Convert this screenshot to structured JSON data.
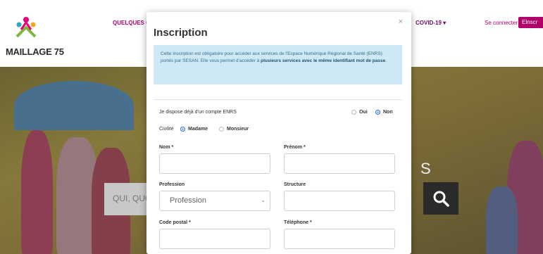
{
  "site": {
    "logo_text": "MAILLAGE 75",
    "nav": {
      "quelques": "QUELQUES O",
      "covid": "COVID-19 ▾",
      "login": "Se connecter",
      "signup_button": "Elnscr"
    },
    "hero": {
      "search_placeholder": "QUI, QUO",
      "side_letter": "S"
    }
  },
  "modal": {
    "title": "Inscription",
    "close": "×",
    "info_text": "Cette inscription est obligatoire pour accéder aux services de l'Espace Numérique Régional de Santé (ENRS) portés par SESAN. Elle vous permet d'accéder à ",
    "info_bold": "plusieurs services avec le même identifiant mot de passe",
    "info_end": ".",
    "enrs_question": "Je dispose déjà d'un compte ENRS",
    "enrs_options": [
      "Oui",
      "Non"
    ],
    "enrs_selected": "Non",
    "civilite_label": "Civilité",
    "civilite_options": [
      "Madame",
      "Monsieur"
    ],
    "civilite_selected": "Madame",
    "fields": {
      "nom_label": "Nom *",
      "prenom_label": "Prénom *",
      "profession_label": "Profession",
      "profession_value": "Profession",
      "structure_label": "Structure",
      "code_postal_label": "Code postal *",
      "telephone_label": "Téléphone *"
    }
  },
  "colors": {
    "brand": "#b0006a",
    "info_bg": "#cfe8f5",
    "radio_on": "#2b6fd1"
  }
}
